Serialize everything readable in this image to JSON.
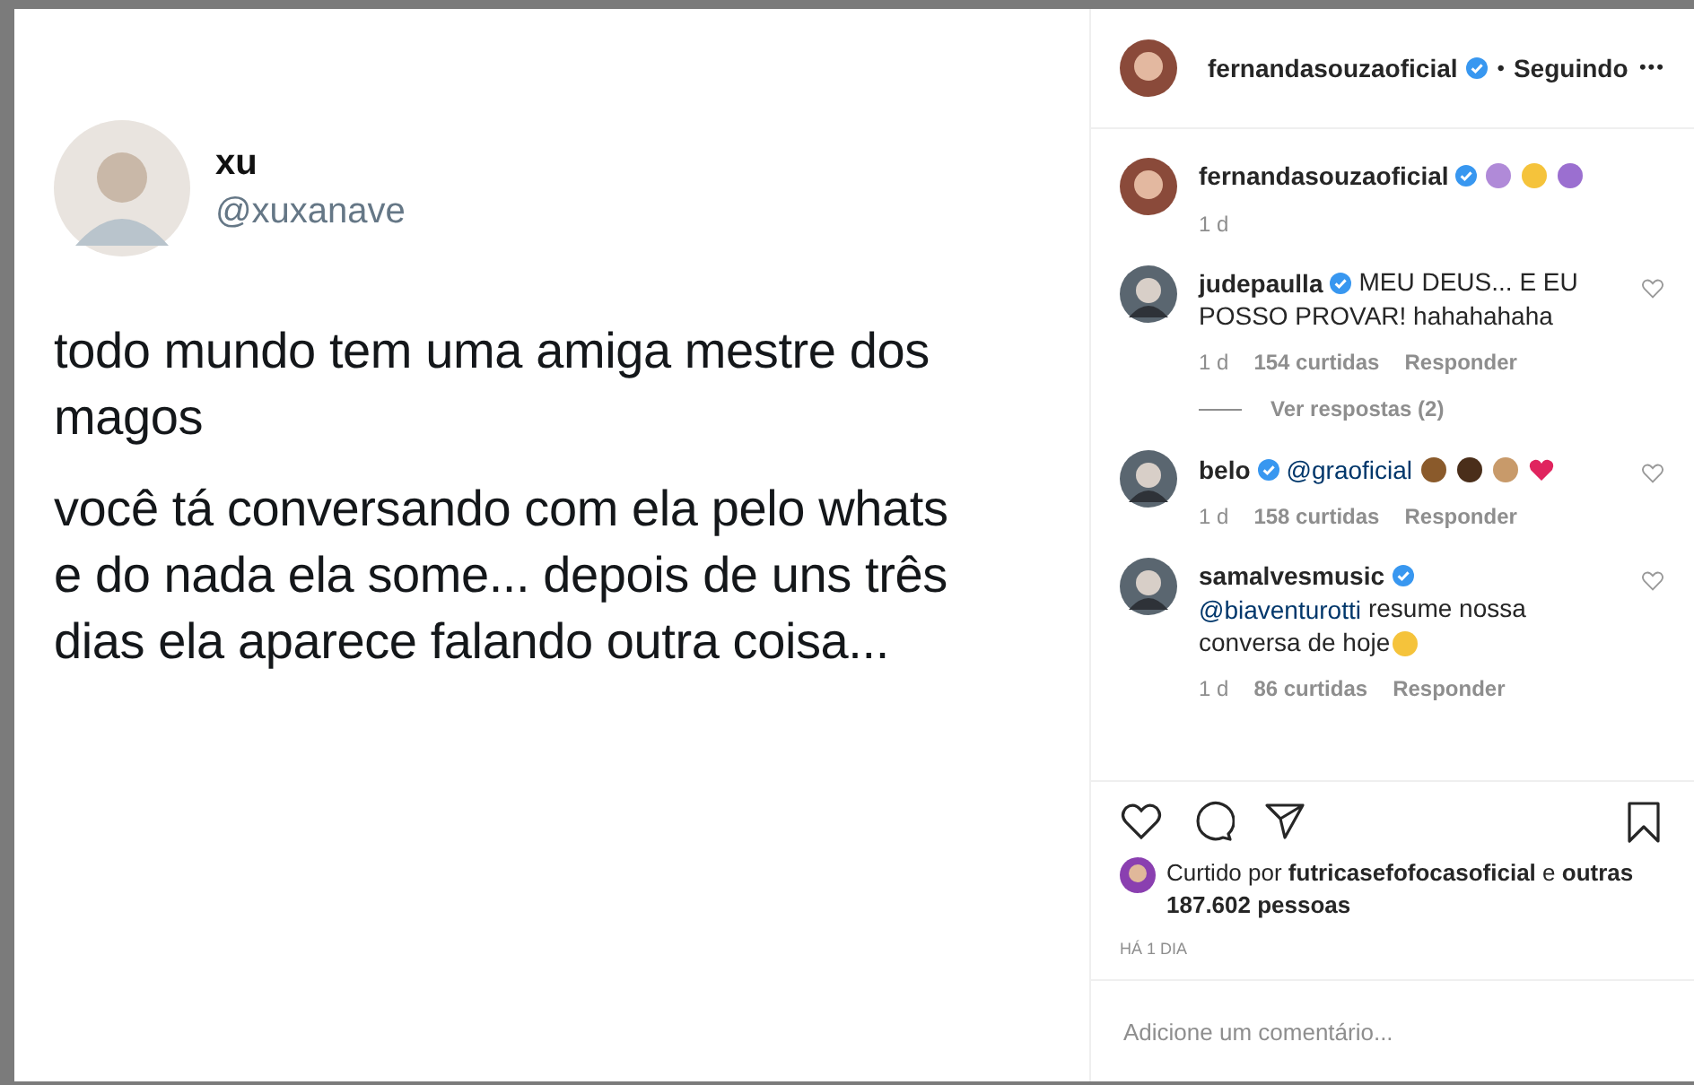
{
  "post": {
    "author_name": "xu",
    "author_handle": "@xuxanave",
    "paragraphs": [
      "todo mundo tem uma amiga mestre dos magos",
      "você tá conversando com ela pelo whats e do nada ela some... depois de uns três dias ela aparece falando outra coisa..."
    ]
  },
  "header": {
    "username": "fernandasouzaoficial",
    "verified": true,
    "separator": "•",
    "follow_state": "Seguindo",
    "more": "•••"
  },
  "caption": {
    "username": "fernandasouzaoficial",
    "verified": true,
    "emojis": [
      {
        "kind": "raise"
      },
      {
        "kind": "laugh"
      },
      {
        "kind": "shrug"
      }
    ],
    "time": "1 d"
  },
  "comments": [
    {
      "username": "judepaulla",
      "verified": true,
      "text": "MEU DEUS... E EU POSSO PROVAR! hahahahaha",
      "time": "1 d",
      "likes": "154 curtidas",
      "reply": "Responder",
      "replies": "Ver respostas (2)"
    },
    {
      "username": "belo",
      "verified": true,
      "mention": "@graoficial",
      "emojis": [
        {
          "kind": "fist"
        },
        {
          "kind": "fist-dark"
        },
        {
          "kind": "ok"
        },
        {
          "kind": "heart"
        }
      ],
      "time": "1 d",
      "likes": "158 curtidas",
      "reply": "Responder"
    },
    {
      "username": "samalvesmusic",
      "verified": true,
      "mention": "@biaventurotti",
      "text": "resume nossa conversa de hoje",
      "emojis": [
        {
          "kind": "laugh"
        }
      ],
      "time": "1 d",
      "likes": "86 curtidas",
      "reply": "Responder"
    }
  ],
  "likes": {
    "prefix": "Curtido por",
    "user": "futricasefofocasoficial",
    "suffix": "e",
    "others": "outras 187.602 pessoas"
  },
  "date": "HÁ 1 DIA",
  "comment_field": {
    "placeholder": "Adicione um comentário..."
  }
}
